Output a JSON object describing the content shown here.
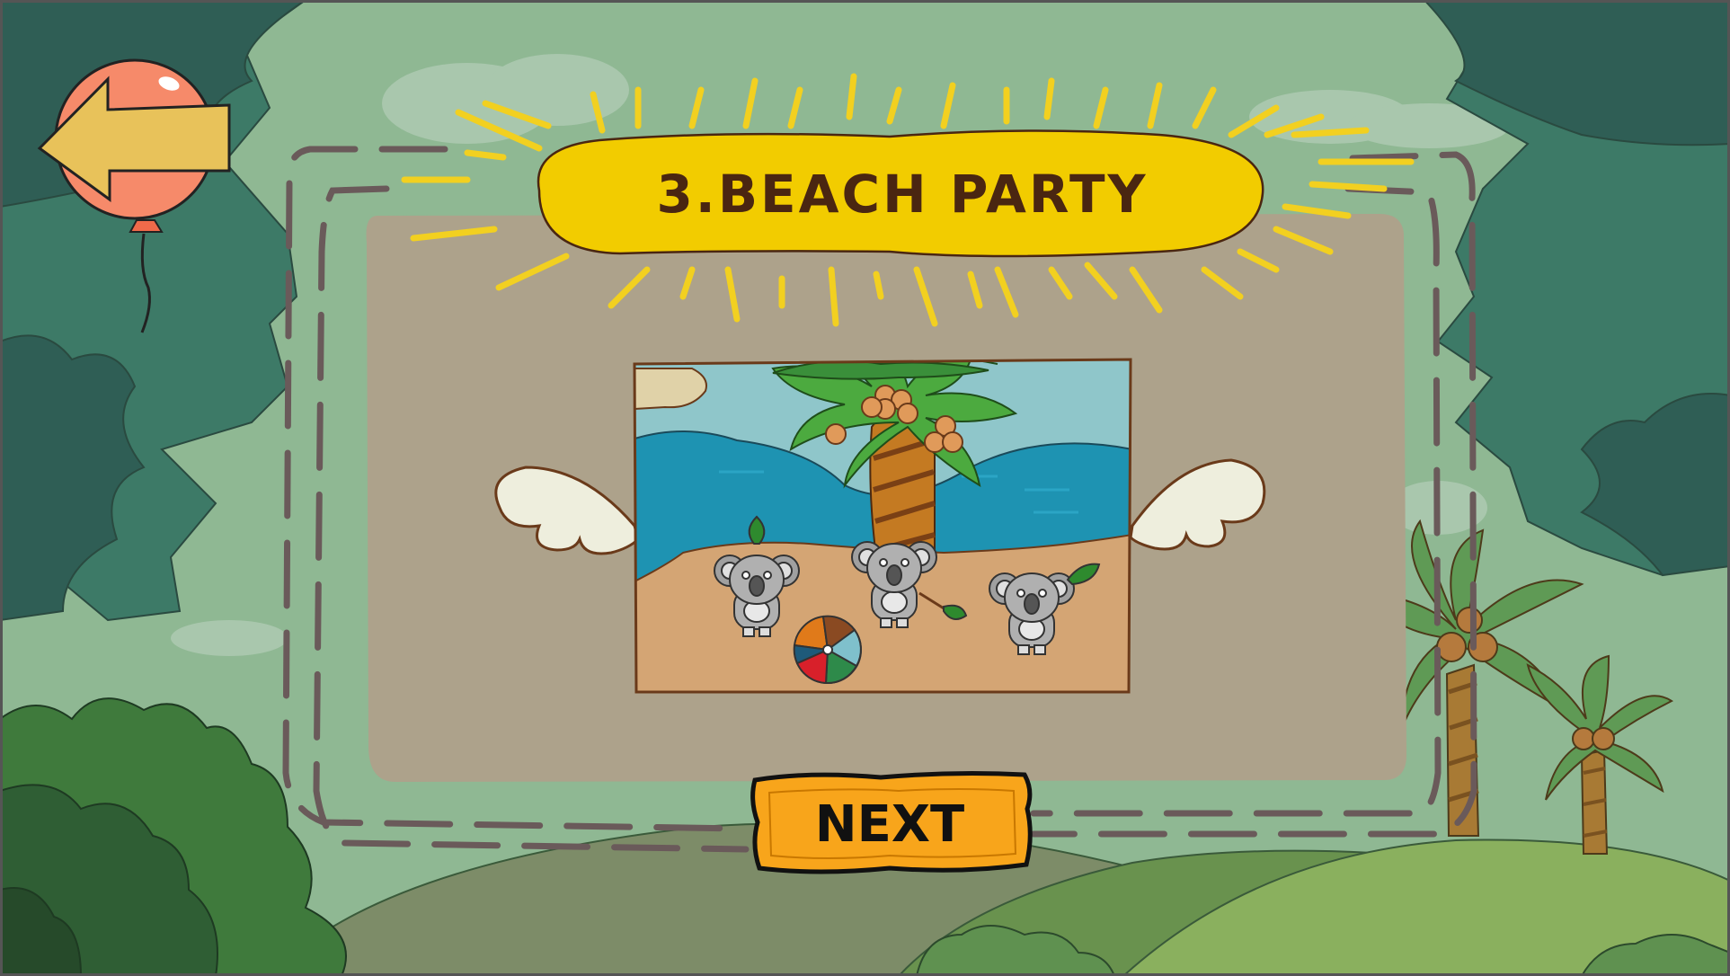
{
  "level": {
    "title": "3.BEACH PARTY",
    "next_label": "NEXT"
  },
  "icons": {
    "back": "back-arrow-balloon-icon",
    "ball": "beach-ball-icon"
  },
  "colors": {
    "background": "#8fb893",
    "panel": "#ada28b",
    "title_banner": "#f2cc00",
    "title_text": "#4a2611",
    "next_button": "#f8a51b",
    "sea": "#1e93b2",
    "sand": "#d4a574",
    "balloon": "#f68a6a",
    "arrow": "#e8c25a"
  }
}
